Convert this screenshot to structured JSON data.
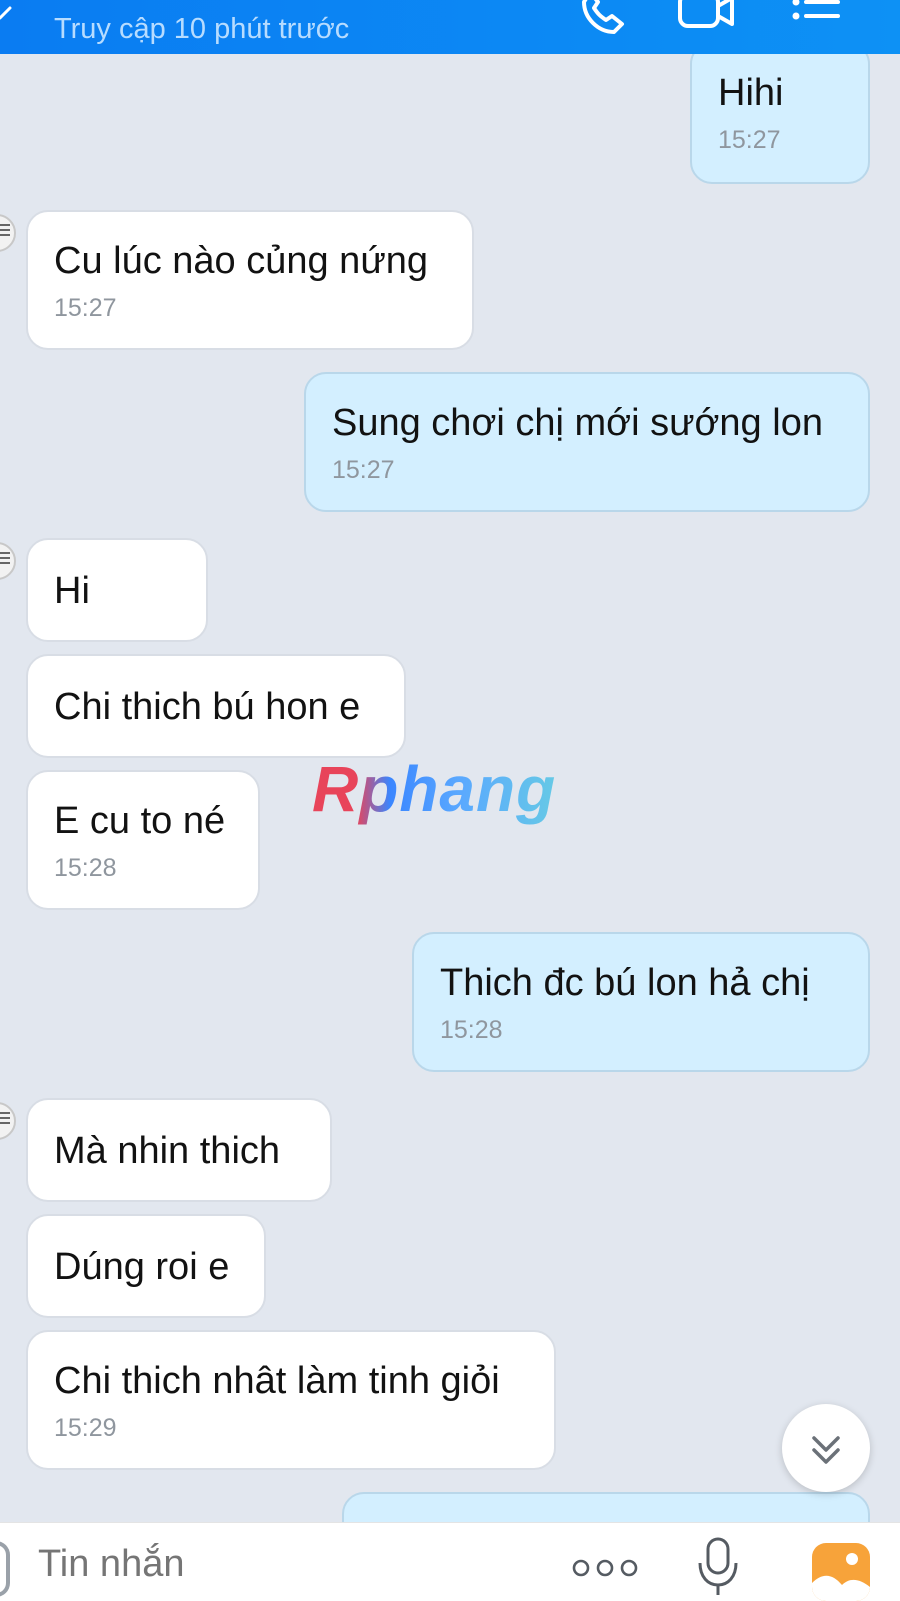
{
  "header": {
    "status": "Truy cập 10 phút trước"
  },
  "messages": [
    {
      "dir": "out",
      "text": "Hihi",
      "time": "15:27"
    },
    {
      "dir": "in",
      "text": "Cu lúc nào củng nứng",
      "time": "15:27"
    },
    {
      "dir": "out",
      "text": "Sung chơi chị mới sướng lon",
      "time": "15:27"
    },
    {
      "dir": "in",
      "text": "Hi",
      "time": ""
    },
    {
      "dir": "in",
      "text": "Chi thich bú hon e",
      "time": ""
    },
    {
      "dir": "in",
      "text": "E cu to né",
      "time": "15:28"
    },
    {
      "dir": "out",
      "text": "Thich đc bú lon hả chị",
      "time": "15:28"
    },
    {
      "dir": "in",
      "text": "Mà nhin thich",
      "time": ""
    },
    {
      "dir": "in",
      "text": "Dúng roi e",
      "time": ""
    },
    {
      "dir": "in",
      "text": "Chi thich nhât làm tinh giỏi",
      "time": "15:29"
    }
  ],
  "watermark": "Rphang",
  "composer": {
    "placeholder": "Tin nhắn"
  },
  "icons": {
    "header": [
      "back-icon",
      "phone-icon",
      "video-icon",
      "menu-icon"
    ],
    "composer": [
      "more-dots-icon",
      "microphone-icon",
      "gallery-icon"
    ],
    "scroll": "chevron-double-down-icon"
  },
  "colors": {
    "header": "#0a7cf2",
    "chat_bg": "#e2e7ef",
    "incoming_bubble": "#ffffff",
    "outgoing_bubble": "#d3efff",
    "time": "#8f969e"
  }
}
